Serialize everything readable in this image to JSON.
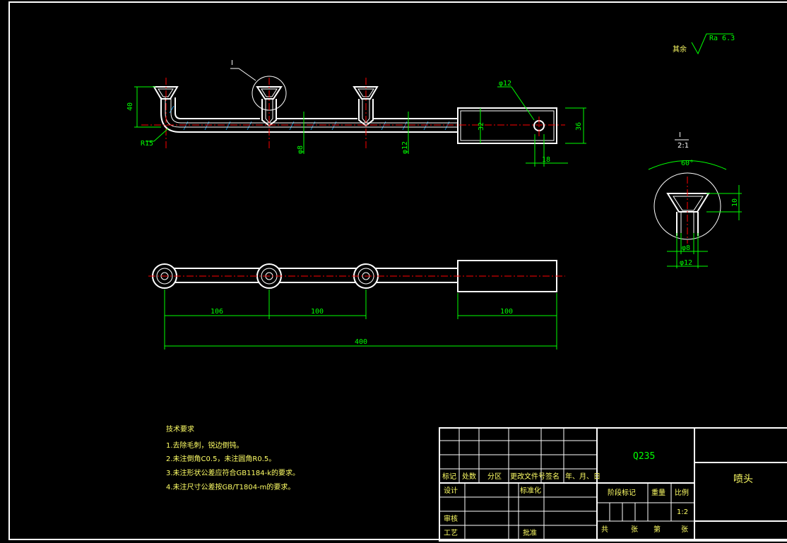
{
  "roughness": {
    "prefix": "其余",
    "value": "Ra 6.3"
  },
  "views": {
    "detail_label": "I",
    "detail_label_section": "I",
    "detail_ratio": "2:1"
  },
  "dimensions": {
    "height_40": "40",
    "radius_r15": "R15",
    "dia_8": "φ8",
    "dia_12": "φ12",
    "hole_12": "φ12",
    "block_32": "32",
    "block_36": "36",
    "block_18": "18",
    "angle_60": "60°",
    "detail_10": "10",
    "detail_d8": "φ8",
    "detail_d12": "φ12",
    "span_106": "106",
    "span_100a": "100",
    "span_100b": "100",
    "total_400": "400"
  },
  "tech_requirements": {
    "title": "技术要求",
    "items": [
      "1.去除毛刺，锐边倒钝。",
      "2.未注倒角C0.5，未注圆角R0.5。",
      "3.未注形状公差应符合GB1184-k的要求。",
      "4.未注尺寸公差按GB/T1804-m的要求。"
    ]
  },
  "title_block": {
    "material": "Q235",
    "part_name": "喷头",
    "headers": [
      "标记",
      "处数",
      "分区",
      "更改文件号",
      "签名",
      "年、月、日"
    ],
    "design": "设计",
    "standardization": "标准化",
    "review": "审核",
    "process": "工艺",
    "approve": "批准",
    "stage_mark": "阶段标记",
    "weight": "重量",
    "scale_label": "比例",
    "scale_value": "1:2",
    "total": "共",
    "sheets": "张",
    "no": "第",
    "sheet": "张"
  },
  "colors": {
    "outline": "#ffffff",
    "dimension": "#00ff00",
    "centerline": "#ff0000",
    "hatch": "#00aaff",
    "text": "#ffff66"
  }
}
